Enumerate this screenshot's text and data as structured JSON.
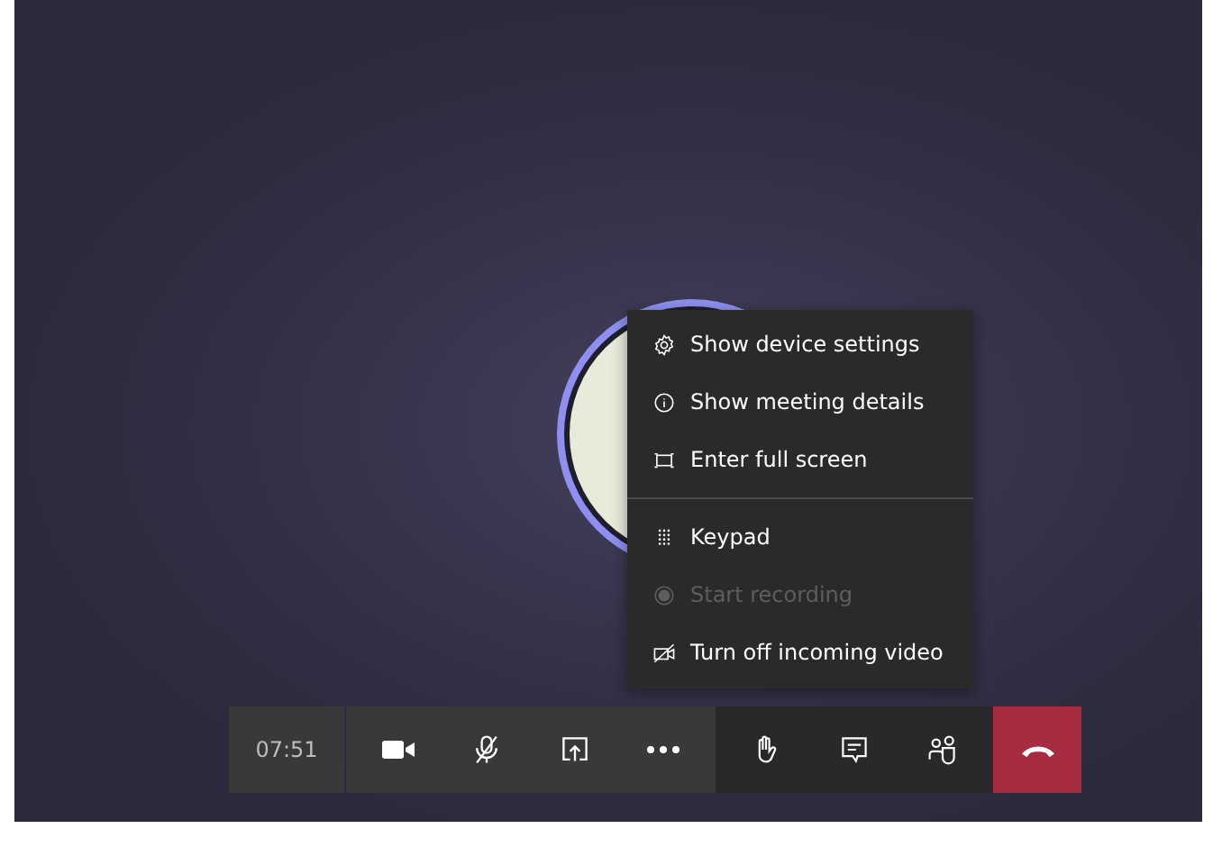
{
  "menu": {
    "sections": [
      [
        {
          "kind": "gear",
          "label": "Show device settings",
          "disabled": false
        },
        {
          "kind": "info",
          "label": "Show meeting details",
          "disabled": false
        },
        {
          "kind": "fullscreen",
          "label": "Enter full screen",
          "disabled": false
        }
      ],
      [
        {
          "kind": "keypad",
          "label": "Keypad",
          "disabled": false
        },
        {
          "kind": "record",
          "label": "Start recording",
          "disabled": true
        },
        {
          "kind": "videooff",
          "label": "Turn off incoming video",
          "disabled": false
        }
      ]
    ]
  },
  "toolbar": {
    "timer": "07:51",
    "mic_muted": true
  }
}
